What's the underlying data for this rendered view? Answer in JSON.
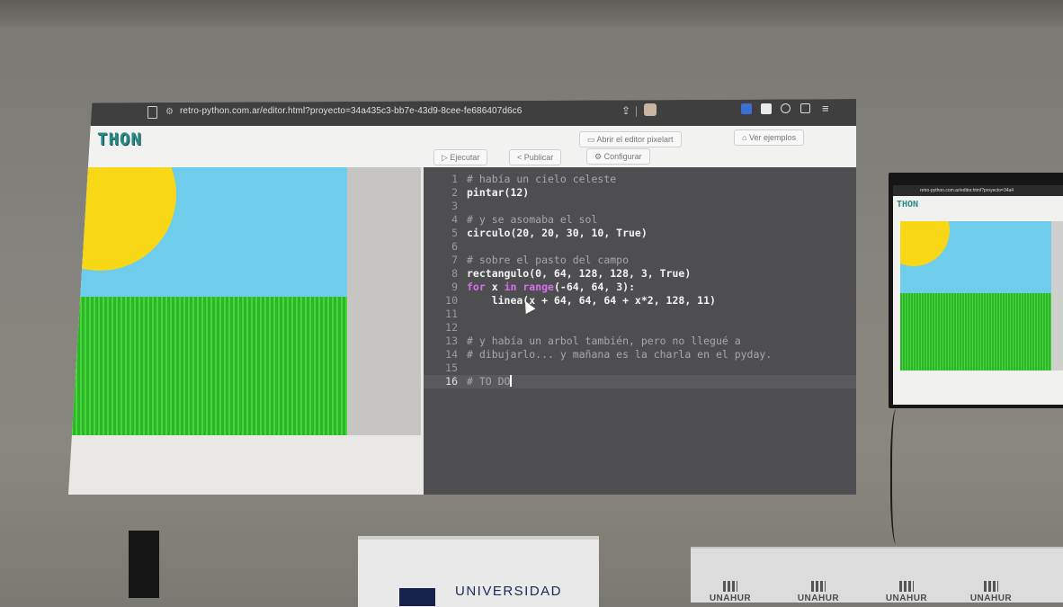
{
  "browser": {
    "url": "retro-python.com.ar/editor.html?proyecto=34a435c3-bb7e-43d9-8cee-fe686407d6c6"
  },
  "app": {
    "logo": "THON",
    "open_pixelart_label": "Abrir el editor pixelart",
    "examples_label": "Ver ejemplos",
    "run_label": "Ejecutar",
    "publish_label": "Publicar",
    "config_label": "Configurar"
  },
  "editor": {
    "active_line": 16,
    "lines": [
      {
        "n": "1",
        "text": "# había un cielo celeste",
        "kind": "comment"
      },
      {
        "n": "2",
        "text": "pintar(12)",
        "kind": "code"
      },
      {
        "n": "3",
        "text": "",
        "kind": "code"
      },
      {
        "n": "4",
        "text": "# y se asomaba el sol",
        "kind": "comment"
      },
      {
        "n": "5",
        "text": "circulo(20, 20, 30, 10, True)",
        "kind": "code"
      },
      {
        "n": "6",
        "text": "",
        "kind": "code"
      },
      {
        "n": "7",
        "text": "# sobre el pasto del campo",
        "kind": "comment"
      },
      {
        "n": "8",
        "text": "rectangulo(0, 64, 128, 128, 3, True)",
        "kind": "code"
      },
      {
        "n": "9",
        "text": "for x in range(-64, 64, 3):",
        "kind": "code"
      },
      {
        "n": "10",
        "text": "    linea(x + 64, 64, 64 + x*2, 128, 11)",
        "kind": "code"
      },
      {
        "n": "11",
        "text": "",
        "kind": "code"
      },
      {
        "n": "12",
        "text": "",
        "kind": "code"
      },
      {
        "n": "13",
        "text": "# y había un arbol también, pero no llegué a",
        "kind": "comment"
      },
      {
        "n": "14",
        "text": "# dibujarlo... y mañana es la charla en el pyday.",
        "kind": "comment"
      },
      {
        "n": "15",
        "text": "",
        "kind": "code"
      },
      {
        "n": "16",
        "text": "# TO DO",
        "kind": "comment"
      }
    ]
  },
  "canvas": {
    "sky_color": "#6ecdea",
    "sun_color": "#f7d716",
    "grass_color": "#2fb52a"
  },
  "tv": {
    "url": "retro-python.com.ar/editor.html?proyecto=34a4",
    "logo": "THON"
  },
  "room": {
    "banner_text": "UNIVERSIDAD",
    "brand_labels": [
      "UNAHUR",
      "UNAHUR",
      "UNAHUR",
      "UNAHUR"
    ]
  }
}
